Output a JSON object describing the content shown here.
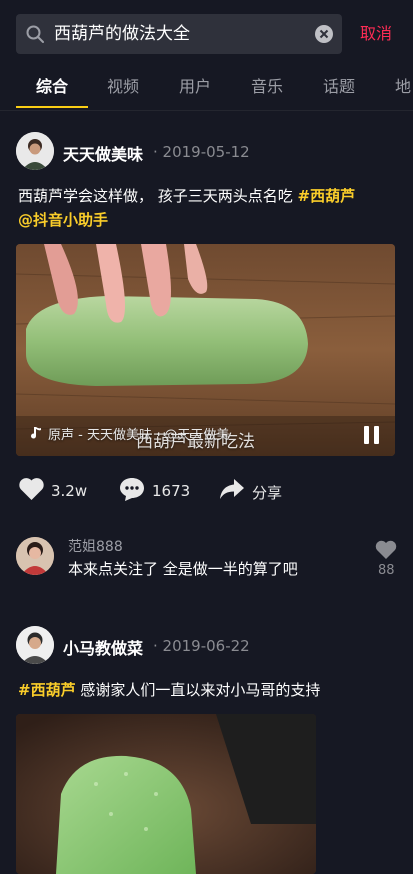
{
  "search": {
    "query": "西葫芦的做法大全",
    "cancel_label": "取消"
  },
  "tabs": [
    {
      "label": "综合"
    },
    {
      "label": "视频"
    },
    {
      "label": "用户"
    },
    {
      "label": "音乐"
    },
    {
      "label": "话题"
    },
    {
      "label": "地"
    }
  ],
  "post1": {
    "author": "天天做美味",
    "date": "· 2019-05-12",
    "caption_text": "西葫芦学会这样做， 孩子三天两头点名吃 ",
    "caption_tag": "#西葫芦",
    "caption_mention": "@抖音小助手",
    "music_credit": "原声 - 天天做美味 · @天天做美",
    "watermark": "西葫芦最新吃法",
    "likes": "3.2w",
    "comments": "1673",
    "share_label": "分享"
  },
  "top_comment": {
    "user": "范姐888",
    "text": "本来点关注了 全是做一半的算了吧",
    "likes": "88"
  },
  "post2": {
    "author": "小马教做菜",
    "date": "· 2019-06-22",
    "caption_tag": "#西葫芦",
    "caption_text": "  感谢家人们一直以来对小马哥的支持"
  },
  "colors": {
    "background": "#161823",
    "accent_red": "#fe2c55",
    "tag_yellow": "#facd2a"
  },
  "icons": [
    "search-icon",
    "clear-icon",
    "music-note-icon",
    "pause-icon",
    "heart-icon",
    "comment-icon",
    "share-icon"
  ]
}
